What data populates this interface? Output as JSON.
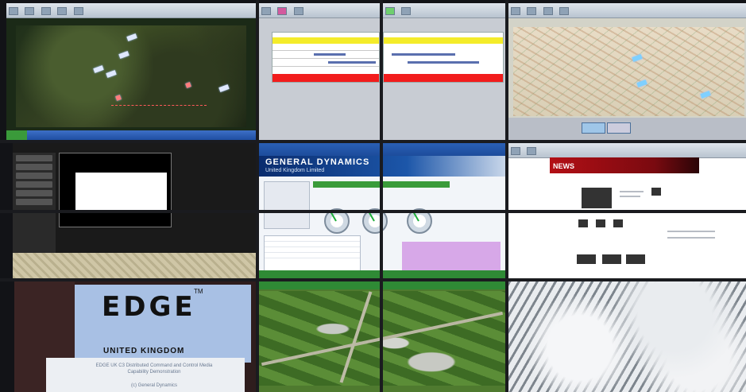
{
  "wall": {
    "panelA": {
      "name": "Terrain view"
    },
    "schedule": {
      "rows": 4
    },
    "gd": {
      "brand": "GENERAL DYNAMICS",
      "sub": "United Kingdom Limited"
    },
    "news": {
      "logo": "NEWS"
    },
    "edge": {
      "logo": "EDGE",
      "tm": "TM",
      "country": "UNITED KINGDOM",
      "caption1": "EDGE UK C3 Distributed Command and Control Media",
      "caption2": "Capability Demonstration",
      "caption3": "(c) General Dynamics"
    },
    "dialog": {
      "title": ""
    }
  },
  "colors": {
    "gd_blue": "#0a2c6e",
    "green_status": "#3a9b3a",
    "schedule_yellow": "#f4ec2a",
    "schedule_red": "#f21c1c",
    "news_red": "#b30f15",
    "edge_blue": "#a8c0e4"
  }
}
